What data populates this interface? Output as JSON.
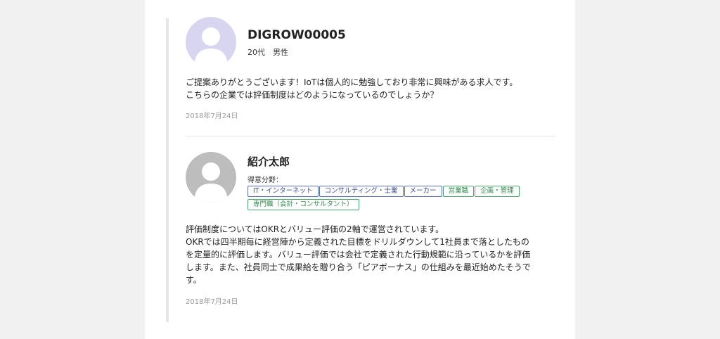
{
  "post1": {
    "name": "DIGROW00005",
    "meta": "20代　男性",
    "body_lines": [
      "ご提案ありがとうございます！IoTは個人的に勉強しており非常に興味がある求人です。",
      "こちらの企業では評価制度はどのようになっているのでしょうか？"
    ],
    "date": "2018年7月24日",
    "avatar_icon": "person-placeholder-icon",
    "avatar_color": "#d8d5f0"
  },
  "post2": {
    "name": "紹介太郎",
    "specialty_label": "得意分野：",
    "tags": [
      {
        "label": "IT・インターネット",
        "color": "blue"
      },
      {
        "label": "コンサルティング・士業",
        "color": "blue"
      },
      {
        "label": "メーカー",
        "color": "blue"
      },
      {
        "label": "営業職",
        "color": "green"
      },
      {
        "label": "企画・管理",
        "color": "green"
      },
      {
        "label": "専門職（会計・コンサルタント）",
        "color": "green"
      }
    ],
    "body_lines": [
      "評価制度についてはOKRとバリュー評価の2軸で運営されています。",
      "OKRでは四半期毎に経営陣から定義された目標をドリルダウンして1社員まで落としたもの",
      "を定量的に評価します。バリュー評価では会社で定義された行動規範に沿っているかを評価",
      "します。また、社員同士で成果給を贈り合う「ピアボーナス」の仕組みを最近始めたそうで",
      "す。"
    ],
    "date": "2018年7月24日",
    "avatar_icon": "person-placeholder-icon",
    "avatar_color": "#bdbdbd"
  },
  "colors": {
    "tag_blue": "#3b4f9a",
    "tag_green": "#2f8a4e"
  }
}
